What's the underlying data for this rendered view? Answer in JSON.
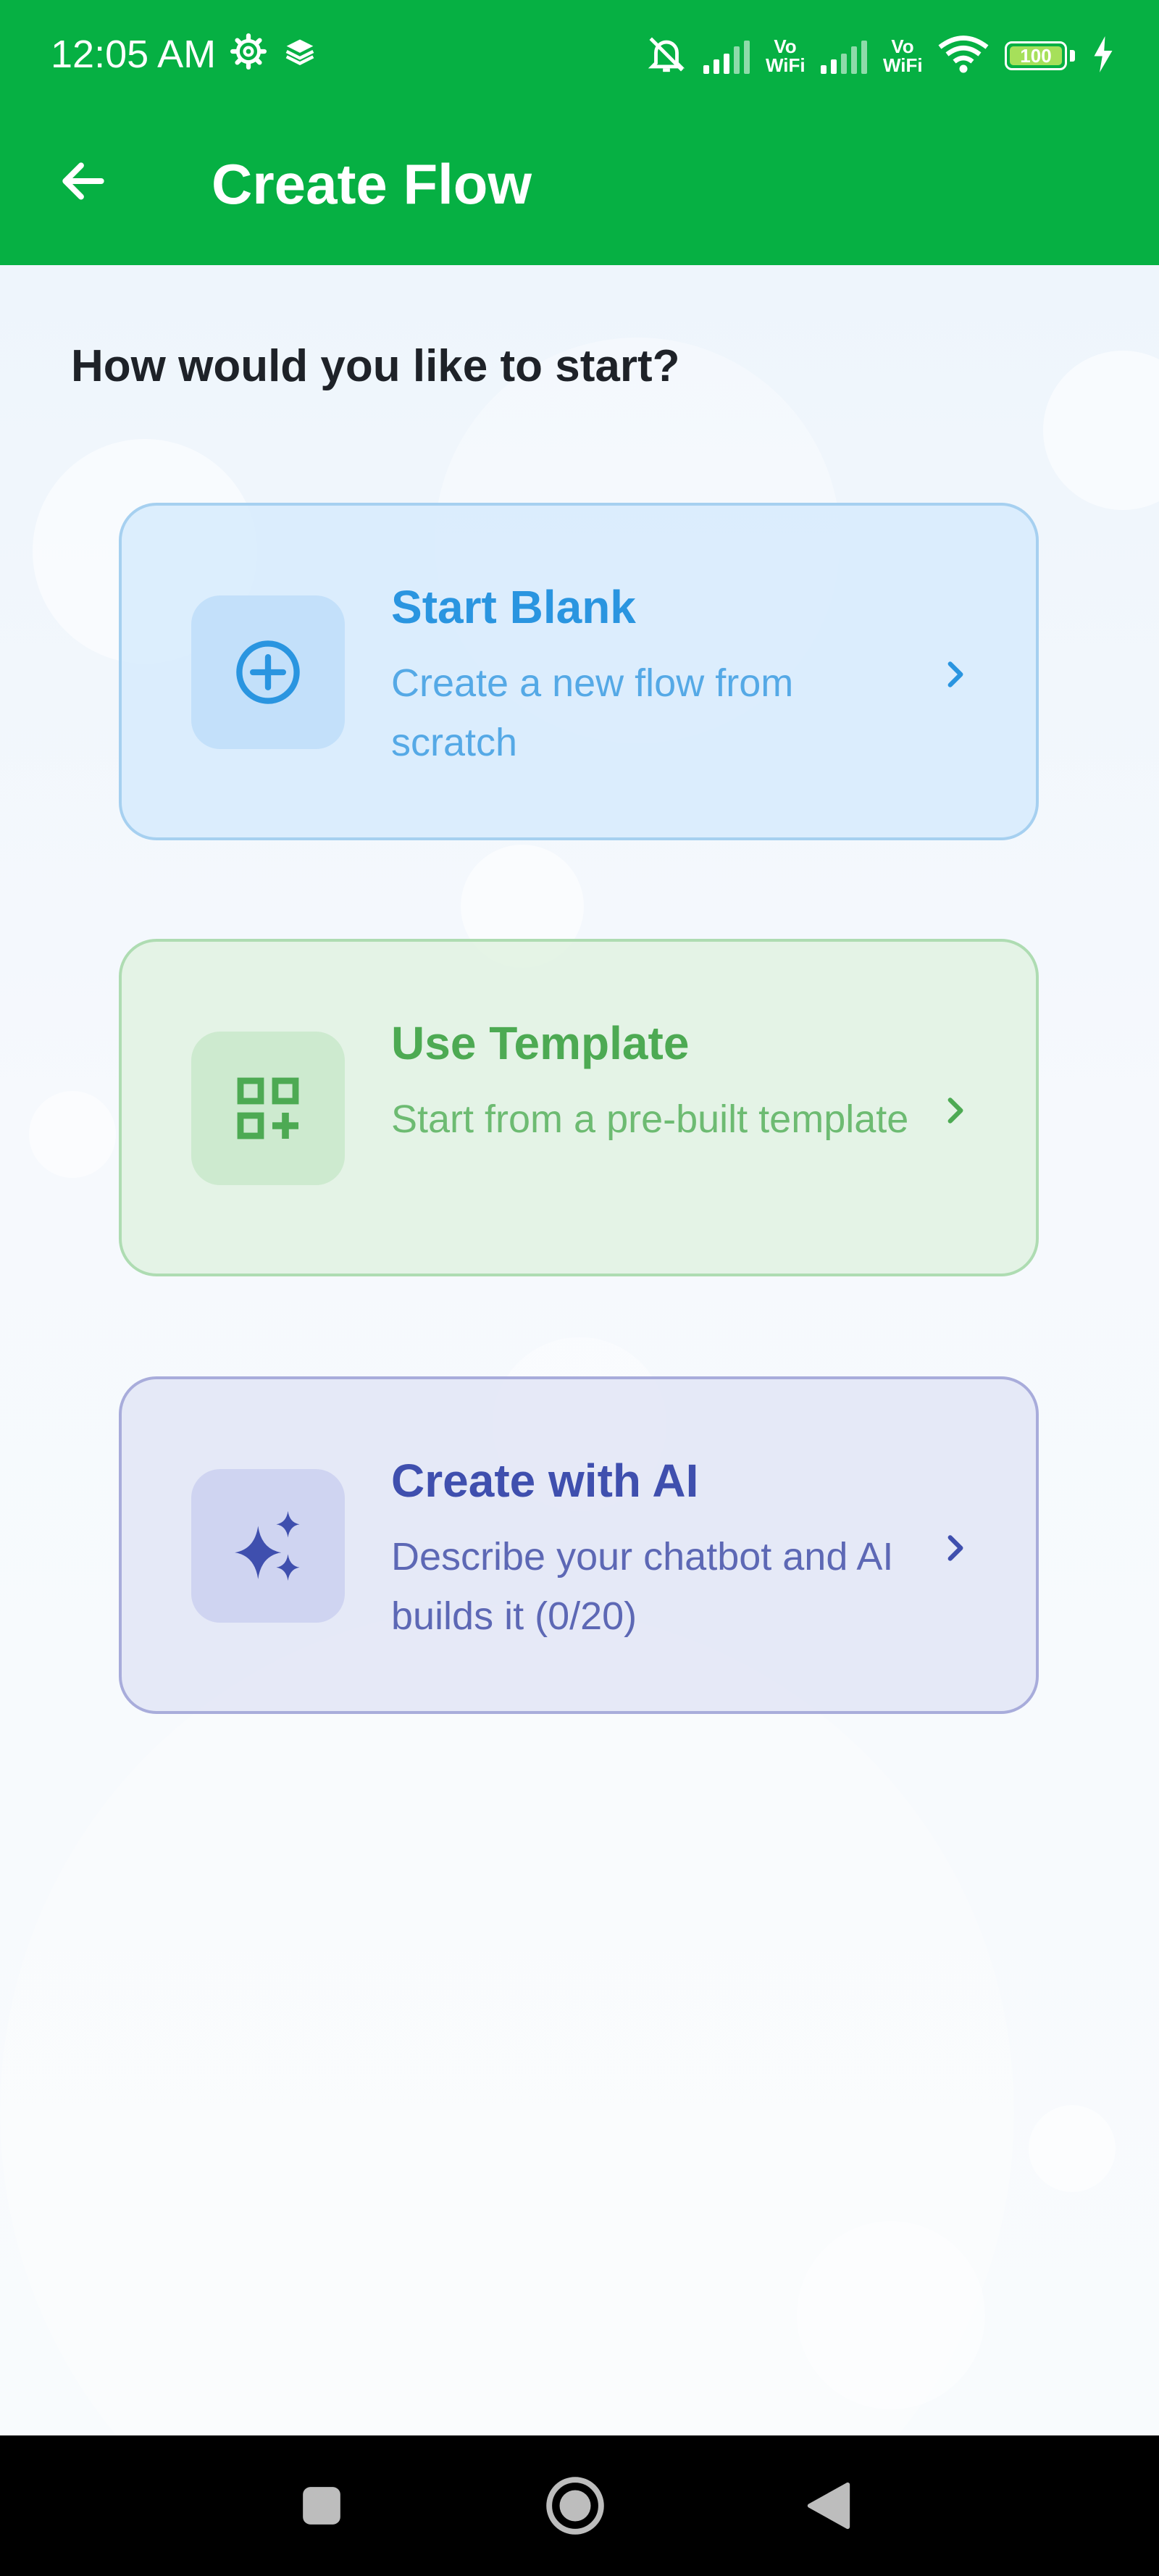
{
  "status_bar": {
    "time": "12:05 AM",
    "battery": "100",
    "vowifi_label_1": "Vo\nWiFi",
    "vowifi_label_2": "Vo\nWiFi",
    "icons": [
      "settings-gear-icon",
      "layers-icon",
      "mute-bell-icon",
      "signal-icon",
      "wifi-icon",
      "battery-icon",
      "charging-bolt-icon"
    ]
  },
  "app_bar": {
    "title": "Create Flow",
    "back_icon": "arrow-left-icon"
  },
  "content": {
    "prompt": "How would you like to start?",
    "options": [
      {
        "title": "Start Blank",
        "description": "Create a new flow from scratch",
        "icon": "plus-circle-icon",
        "accent": "#2a95e0"
      },
      {
        "title": "Use Template",
        "description": "Start from a pre-built template",
        "icon": "grid-plus-icon",
        "accent": "#4daa53"
      },
      {
        "title": "Create with AI",
        "description": "Describe your chatbot and AI builds it (0/20)",
        "icon": "sparkles-icon",
        "accent": "#3f4fae"
      }
    ]
  },
  "nav_bar": {
    "buttons": [
      "recents-square-icon",
      "home-circle-icon",
      "back-triangle-icon"
    ]
  },
  "colors": {
    "brand_green": "#06b043"
  }
}
